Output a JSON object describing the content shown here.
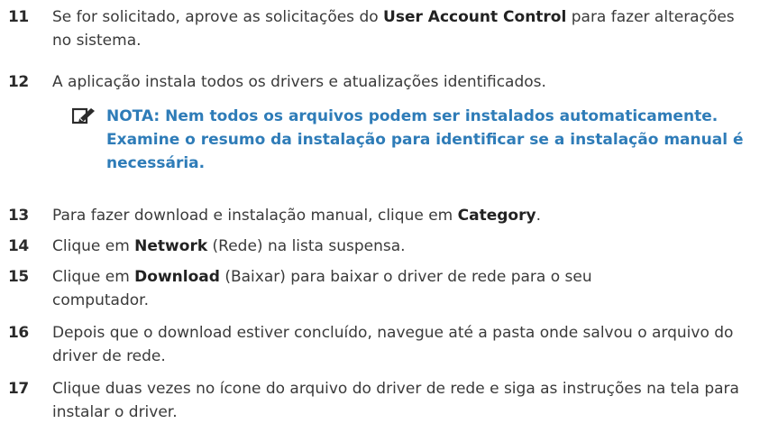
{
  "steps": [
    {
      "number": "11",
      "before": "Se for solicitado, aprove as solicitações do ",
      "bold": "User Account Control",
      "after": " para fazer alterações no sistema."
    },
    {
      "number": "12",
      "text": "A aplicação instala todos os drivers e atualizações identificados."
    },
    {
      "number": "13",
      "before": "Para fazer download e instalação manual, clique em ",
      "bold": "Category",
      "after": "."
    },
    {
      "number": "14",
      "before": "Clique em ",
      "bold": "Network",
      "after": " (Rede) na lista suspensa."
    },
    {
      "number": "15",
      "before": "Clique em ",
      "bold": "Download",
      "after": " (Baixar) para baixar o driver de rede para o seu computador."
    },
    {
      "number": "16",
      "text": "Depois que o download estiver concluído, navegue até a pasta onde salvou o arquivo do driver de rede."
    },
    {
      "number": "17",
      "text": "Clique duas vezes no ícone do arquivo do driver de rede e siga as instruções na tela para instalar o driver."
    }
  ],
  "note": {
    "text": "NOTA: Nem todos os arquivos podem ser instalados automaticamente. Examine o resumo da instalação para identificar se a instalação manual é necessária.",
    "icon": "pencil-note-icon",
    "color": "#2e7cb8"
  }
}
